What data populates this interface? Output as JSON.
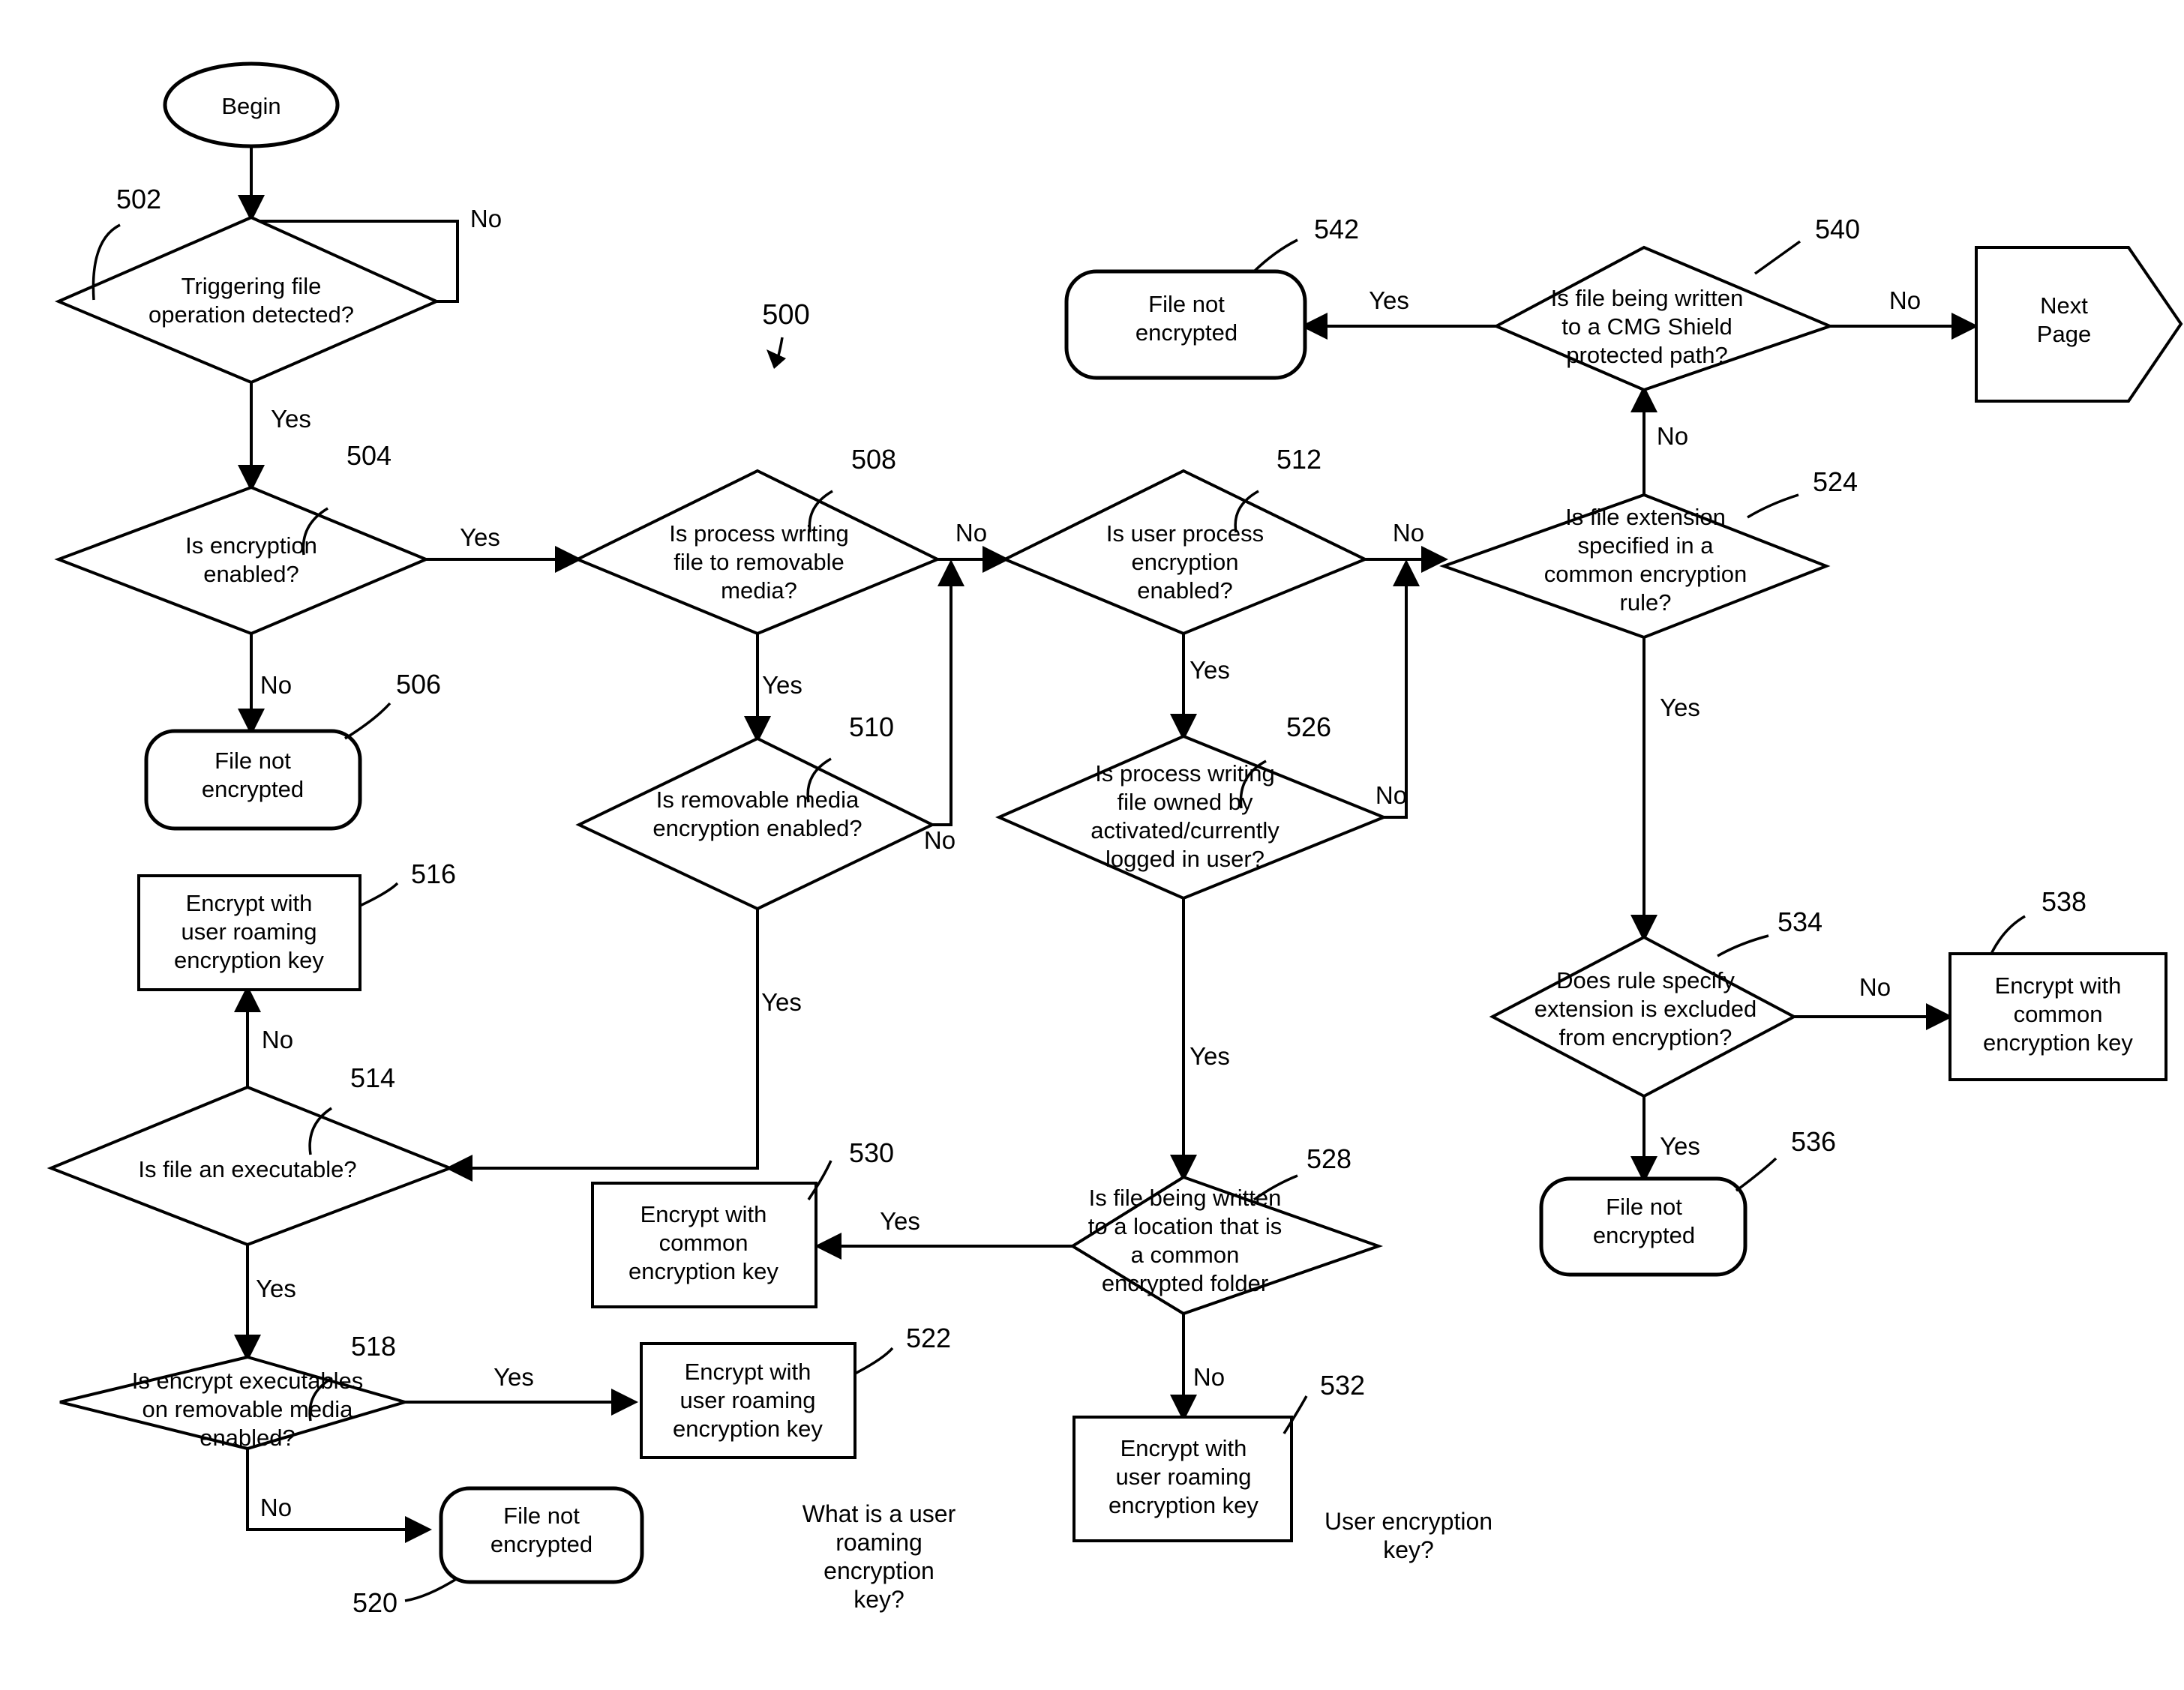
{
  "figure": {
    "number": "500",
    "title": "File encryption decision flowchart"
  },
  "nodes": {
    "begin": {
      "ref": "",
      "label": "Begin",
      "shape": "ellipse"
    },
    "n502": {
      "ref": "502",
      "label": "Triggering file operation detected?",
      "lines": [
        "Triggering file",
        "operation detected?"
      ],
      "shape": "decision"
    },
    "n504": {
      "ref": "504",
      "label": "Is encryption enabled?",
      "lines": [
        "Is encryption",
        "enabled?"
      ],
      "shape": "decision"
    },
    "n506": {
      "ref": "506",
      "label": "File not encrypted",
      "lines": [
        "File not",
        "encrypted"
      ],
      "shape": "terminator"
    },
    "n508": {
      "ref": "508",
      "label": "Is process writing file to removable media?",
      "lines": [
        "Is process writing",
        "file to removable",
        "media?"
      ],
      "shape": "decision"
    },
    "n510": {
      "ref": "510",
      "label": "Is removable media encryption enabled?",
      "lines": [
        "Is removable media",
        "encryption enabled?"
      ],
      "shape": "decision"
    },
    "n512": {
      "ref": "512",
      "label": "Is user process encryption enabled?",
      "lines": [
        "Is user process",
        "encryption",
        "enabled?"
      ],
      "shape": "decision"
    },
    "n514": {
      "ref": "514",
      "label": "Is file an executable?",
      "lines": [
        "Is file an executable?"
      ],
      "shape": "decision"
    },
    "n516": {
      "ref": "516",
      "label": "Encrypt with user roaming encryption key",
      "lines": [
        "Encrypt with",
        "user roaming",
        "encryption key"
      ],
      "shape": "process"
    },
    "n518": {
      "ref": "518",
      "label": "Is encrypt executables on removable media enabled?",
      "lines": [
        "Is encrypt executables",
        "on removable media",
        "enabled?"
      ],
      "shape": "decision"
    },
    "n520": {
      "ref": "520",
      "label": "File not encrypted",
      "lines": [
        "File not",
        "encrypted"
      ],
      "shape": "terminator"
    },
    "n522": {
      "ref": "522",
      "label": "Encrypt with user roaming encryption key",
      "lines": [
        "Encrypt with",
        "user roaming",
        "encryption key"
      ],
      "shape": "process"
    },
    "n524": {
      "ref": "524",
      "label": "Is file extension specified in a common encryption rule?",
      "lines": [
        "Is file extension",
        "specified in a",
        "common encryption",
        "rule?"
      ],
      "shape": "decision"
    },
    "n526": {
      "ref": "526",
      "label": "Is process writing file owned by activated/currently logged in user?",
      "lines": [
        "Is process writing",
        "file owned by",
        "activated/currently",
        "logged in user?"
      ],
      "shape": "decision"
    },
    "n528": {
      "ref": "528",
      "label": "Is file being written to a location that is a common encrypted folder",
      "lines": [
        "Is file being written",
        "to a location that is",
        "a common",
        "encrypted folder"
      ],
      "shape": "decision"
    },
    "n530": {
      "ref": "530",
      "label": "Encrypt with common encryption key",
      "lines": [
        "Encrypt with",
        "common",
        "encryption key"
      ],
      "shape": "process"
    },
    "n532": {
      "ref": "532",
      "label": "Encrypt with user roaming encryption key",
      "lines": [
        "Encrypt with",
        "user roaming",
        "encryption key"
      ],
      "shape": "process"
    },
    "n534": {
      "ref": "534",
      "label": "Does rule specify extension is excluded from encryption?",
      "lines": [
        "Does rule specify",
        "extension is excluded",
        "from encryption?"
      ],
      "shape": "decision"
    },
    "n536": {
      "ref": "536",
      "label": "File not encrypted",
      "lines": [
        "File not",
        "encrypted"
      ],
      "shape": "terminator"
    },
    "n538": {
      "ref": "538",
      "label": "Encrypt with common encryption key",
      "lines": [
        "Encrypt with",
        "common",
        "encryption key"
      ],
      "shape": "process"
    },
    "n540": {
      "ref": "540",
      "label": "Is file being written to a CMG Shield protected path?",
      "lines": [
        "Is file being written",
        "to a CMG Shield",
        "protected path?"
      ],
      "shape": "decision"
    },
    "n542": {
      "ref": "542",
      "label": "File not encrypted",
      "lines": [
        "File not",
        "encrypted"
      ],
      "shape": "terminator"
    },
    "nextpage": {
      "ref": "",
      "label": "Next Page",
      "lines": [
        "Next",
        "Page"
      ],
      "shape": "offpage"
    }
  },
  "edge_labels": {
    "e502_no": "No",
    "e502_yes": "Yes",
    "e504_yes": "Yes",
    "e504_no": "No",
    "e508_no": "No",
    "e508_yes": "Yes",
    "e510_no": "No",
    "e510_yes": "Yes",
    "e512_no": "No",
    "e512_yes": "Yes",
    "e514_no": "No",
    "e514_yes": "Yes",
    "e518_yes": "Yes",
    "e518_no": "No",
    "e524_no": "No",
    "e524_yes": "Yes",
    "e526_no": "No",
    "e526_yes": "Yes",
    "e528_yes": "Yes",
    "e528_no": "No",
    "e534_no": "No",
    "e534_yes": "Yes",
    "e540_yes": "Yes",
    "e540_no": "No"
  },
  "notes": [
    {
      "id": "note-user-roaming-key",
      "lines": [
        "What is a user",
        "roaming",
        "encryption",
        "key?"
      ]
    },
    {
      "id": "note-user-encryption-key",
      "lines": [
        "User encryption",
        "key?"
      ]
    }
  ],
  "colors": {
    "line": "#000000",
    "background": "#ffffff",
    "text": "#000000"
  }
}
